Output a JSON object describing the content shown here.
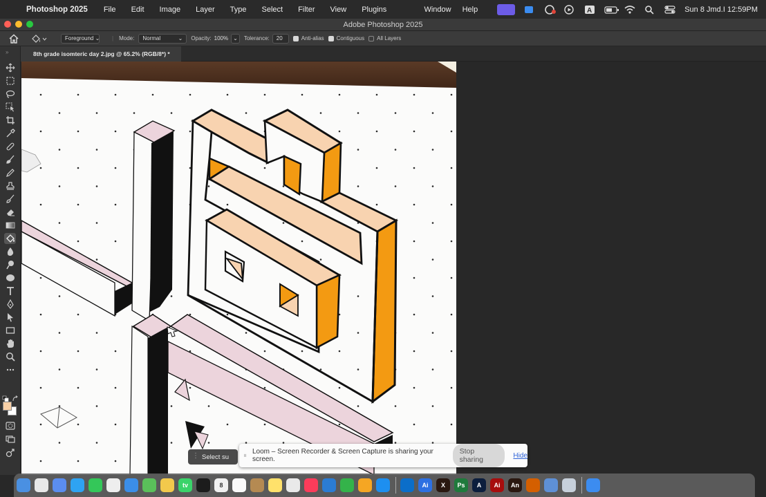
{
  "menubar": {
    "app_name": "Photoshop 2025",
    "menus": [
      "File",
      "Edit",
      "Image",
      "Layer",
      "Type",
      "Select",
      "Filter",
      "View",
      "Plugins"
    ],
    "right_menus": [
      "Window",
      "Help"
    ],
    "clock": "Sun 8 Jmd.I  12:59PM"
  },
  "window": {
    "title": "Adobe Photoshop 2025"
  },
  "options_bar": {
    "tool_preset": "Foreground",
    "mode_label": "Mode:",
    "mode_value": "Normal",
    "opacity_label": "Opacity:",
    "opacity_value": "100%",
    "tolerance_label": "Tolerance:",
    "tolerance_value": "20",
    "anti_alias_label": "Anti-alias",
    "anti_alias_checked": true,
    "contiguous_label": "Contiguous",
    "contiguous_checked": true,
    "all_layers_label": "All Layers",
    "all_layers_checked": false
  },
  "document_tab": {
    "label": "8th grade isomteric day 2.jpg @ 65.2% (RGB/8*) *"
  },
  "toolbar": {
    "tools": [
      "move-tool",
      "marquee-tool",
      "lasso-tool",
      "object-select-tool",
      "crop-tool",
      "eyedropper-tool",
      "healing-brush-tool",
      "brush-tool",
      "clone-stamp-tool",
      "history-brush-tool",
      "eraser-tool",
      "paint-bucket-tool",
      "blur-tool",
      "dodge-tool",
      "pen-tool",
      "type-tool",
      "path-select-tool",
      "rectangle-tool",
      "hand-tool",
      "zoom-tool",
      "more-tools"
    ],
    "active_tool": "paint-bucket-tool",
    "foreground_color": "#f7cfa6",
    "background_color": "#ffffff"
  },
  "canvas_colors": {
    "light_peach": "#f8d3b0",
    "orange": "#f39a12",
    "pink": "#ecd4dc",
    "ink": "#111111",
    "paper": "#fbfbfa"
  },
  "floating_hint": {
    "label": "Select su"
  },
  "loom_banner": {
    "message": "Loom – Screen Recorder & Screen Capture is sharing your screen.",
    "stop_label": "Stop sharing",
    "hide_label": "Hide"
  },
  "dock": {
    "apps": [
      "Finder",
      "Launchpad",
      "Safari",
      "Messages",
      "Chrome",
      "Mail",
      "Maps",
      "Photos",
      "FaceTime",
      "Apple TV",
      "Reminders",
      "Calendar",
      "Contacts",
      "Notes",
      "Freeform",
      "Music",
      "Keynote",
      "Numbers",
      "Pages",
      "App Store",
      "Outlook",
      "Bluetooth",
      "Illustrator",
      "Excel",
      "Photoshop",
      "Acrobat",
      "Illustrator",
      "Animate",
      "Preview",
      "Cricut",
      "Loom",
      "Trash"
    ],
    "calendar_day": "8"
  }
}
